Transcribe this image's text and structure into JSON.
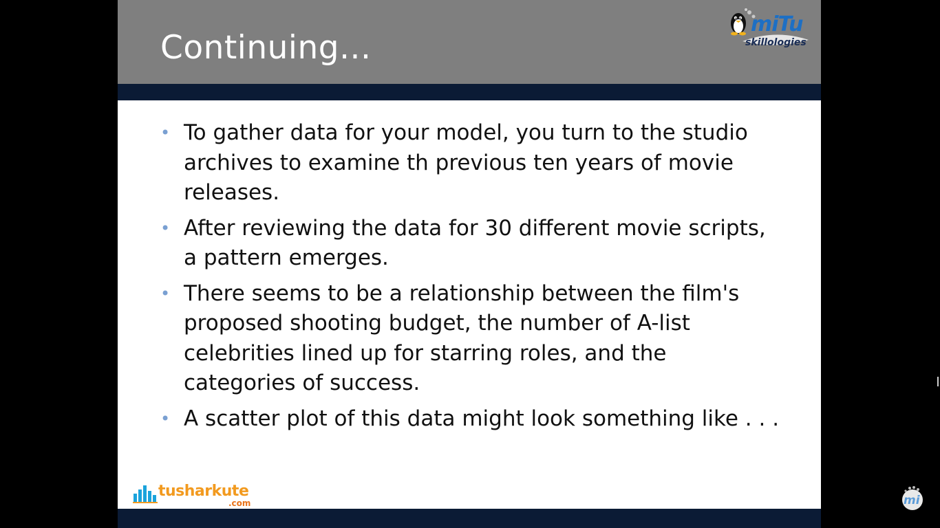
{
  "slide": {
    "title": "Continuing...",
    "bullets": [
      "To gather data for your model, you turn to the studio archives to examine th previous ten years of movie releases.",
      "After reviewing the data for 30 different movie scripts, a pattern emerges.",
      "There seems to be a relationship between the film's proposed shooting budget, the number of A-list celebrities lined up for starring roles, and the categories of success.",
      "A scatter plot of this data might look something like . . ."
    ],
    "bullet_glyph": "•"
  },
  "logos": {
    "mitu_title": "miTu",
    "mitu_sub": "skillologies",
    "tk_name": "tusharkute",
    "tk_com": ".com",
    "watermark": "mi"
  },
  "colors": {
    "header_gray": "#7f7f7f",
    "band_navy": "#0b1b35",
    "bullet_blue": "#7aa0d2",
    "text": "#111111",
    "tk_orange": "#f29a1f",
    "tk_blue": "#1aa3dc",
    "mitu_blue": "#1d6fc4"
  },
  "icons": {
    "mitu_logo": "penguin-icon",
    "tk_logo": "bar-chart-icon",
    "watermark": "mi-logo-icon"
  }
}
